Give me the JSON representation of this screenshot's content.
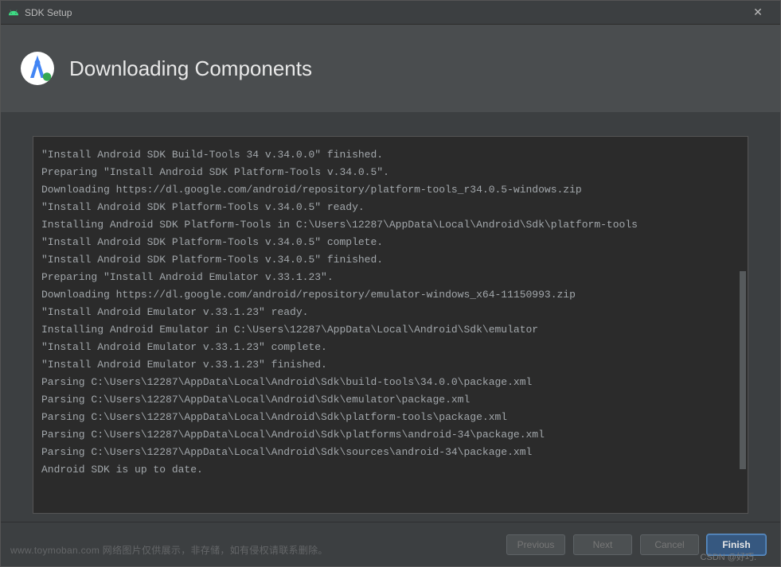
{
  "titlebar": {
    "title": "SDK Setup",
    "close_glyph": "✕"
  },
  "header": {
    "heading": "Downloading Components"
  },
  "log": {
    "lines": [
      "\"Install Android SDK Build-Tools 34 v.34.0.0\" finished.",
      "Preparing \"Install Android SDK Platform-Tools v.34.0.5\".",
      "Downloading https://dl.google.com/android/repository/platform-tools_r34.0.5-windows.zip",
      "\"Install Android SDK Platform-Tools v.34.0.5\" ready.",
      "Installing Android SDK Platform-Tools in C:\\Users\\12287\\AppData\\Local\\Android\\Sdk\\platform-tools",
      "\"Install Android SDK Platform-Tools v.34.0.5\" complete.",
      "\"Install Android SDK Platform-Tools v.34.0.5\" finished.",
      "Preparing \"Install Android Emulator v.33.1.23\".",
      "Downloading https://dl.google.com/android/repository/emulator-windows_x64-11150993.zip",
      "\"Install Android Emulator v.33.1.23\" ready.",
      "Installing Android Emulator in C:\\Users\\12287\\AppData\\Local\\Android\\Sdk\\emulator",
      "\"Install Android Emulator v.33.1.23\" complete.",
      "\"Install Android Emulator v.33.1.23\" finished.",
      "Parsing C:\\Users\\12287\\AppData\\Local\\Android\\Sdk\\build-tools\\34.0.0\\package.xml",
      "Parsing C:\\Users\\12287\\AppData\\Local\\Android\\Sdk\\emulator\\package.xml",
      "Parsing C:\\Users\\12287\\AppData\\Local\\Android\\Sdk\\platform-tools\\package.xml",
      "Parsing C:\\Users\\12287\\AppData\\Local\\Android\\Sdk\\platforms\\android-34\\package.xml",
      "Parsing C:\\Users\\12287\\AppData\\Local\\Android\\Sdk\\sources\\android-34\\package.xml",
      "Android SDK is up to date."
    ]
  },
  "footer": {
    "previous": "Previous",
    "next": "Next",
    "cancel": "Cancel",
    "finish": "Finish"
  },
  "watermark": {
    "left": "www.toymoban.com  网络图片仅供展示，非存储，如有侵权请联系删除。",
    "right": "CSDN @好巧."
  }
}
